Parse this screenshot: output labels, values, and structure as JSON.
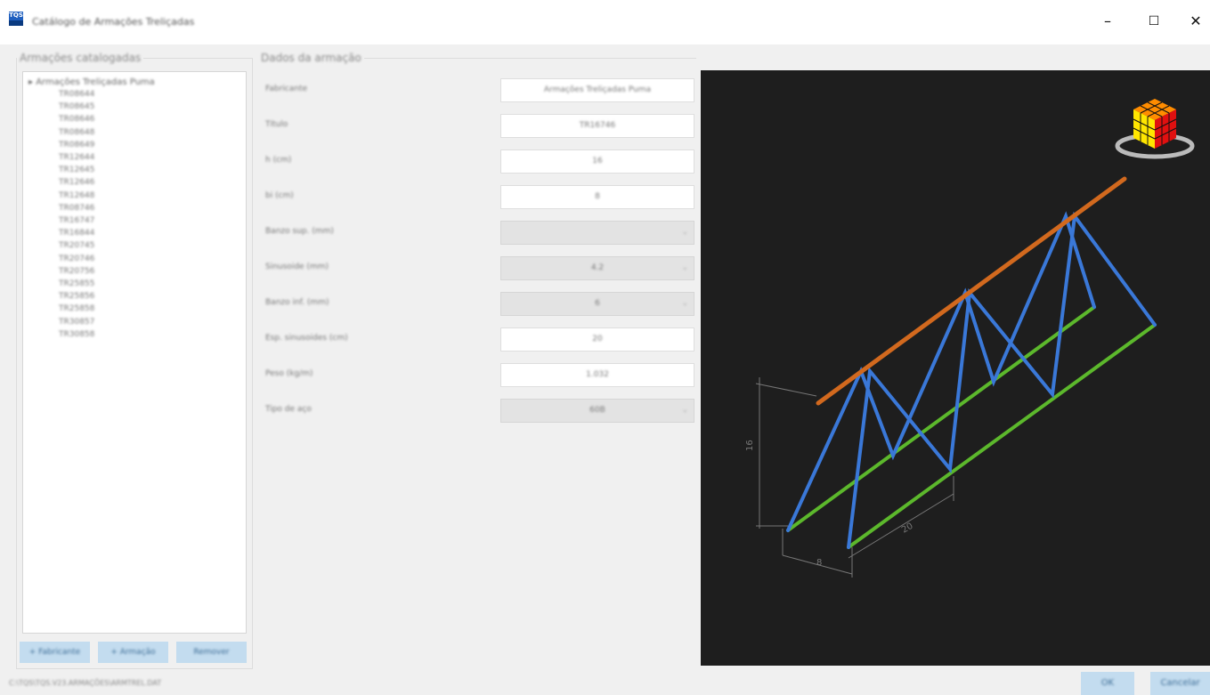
{
  "window": {
    "app_icon_text": "TQS",
    "title": "Catálogo de Armações Treliçadas",
    "minimize": "–",
    "maximize": "☐",
    "close": "✕"
  },
  "left_panel": {
    "legend": "Armações catalogadas",
    "root_label": "Armações Treliçadas Puma",
    "items": [
      "TR08644",
      "TR08645",
      "TR08646",
      "TR08648",
      "TR08649",
      "TR12644",
      "TR12645",
      "TR12646",
      "TR12648",
      "TR08746",
      "TR16747",
      "TR16844",
      "TR20745",
      "TR20746",
      "TR20756",
      "TR25855",
      "TR25856",
      "TR25858",
      "TR30857",
      "TR30858"
    ],
    "buttons": {
      "new_catalog": "+ Fabricante",
      "new_rebar": "+ Armação",
      "remove": "Remover"
    }
  },
  "data_panel": {
    "legend": "Dados da armação",
    "fields": [
      {
        "label": "Fabricante",
        "value": "Armações Treliçadas Puma"
      },
      {
        "label": "Título",
        "value": "TR16746"
      },
      {
        "label": "h (cm)",
        "value": "16"
      },
      {
        "label": "bi (cm)",
        "value": "8"
      },
      {
        "label": "Banzo sup. (mm)",
        "value": ""
      },
      {
        "label": "Sinusoide (mm)",
        "value": "4.2"
      },
      {
        "label": "Banzo inf. (mm)",
        "value": "6"
      },
      {
        "label": "Esp. sinusoides (cm)",
        "value": "20"
      },
      {
        "label": "Peso (kg/m)",
        "value": "1.032"
      },
      {
        "label": "Tipo de aço",
        "value": "60B"
      }
    ]
  },
  "viewport": {
    "dim_h": "16",
    "dim_b": "8",
    "dim_s": "20",
    "top_chord_color": "#d2691e",
    "diagonal_color": "#3a78d8",
    "bottom_chord_color": "#5cb82c"
  },
  "status": {
    "path": "C:\\TQS\\TQS.V23.ARMAÇÕES\\ARMTREL.DAT"
  },
  "footer": {
    "ok": "OK",
    "cancel": "Cancelar"
  }
}
